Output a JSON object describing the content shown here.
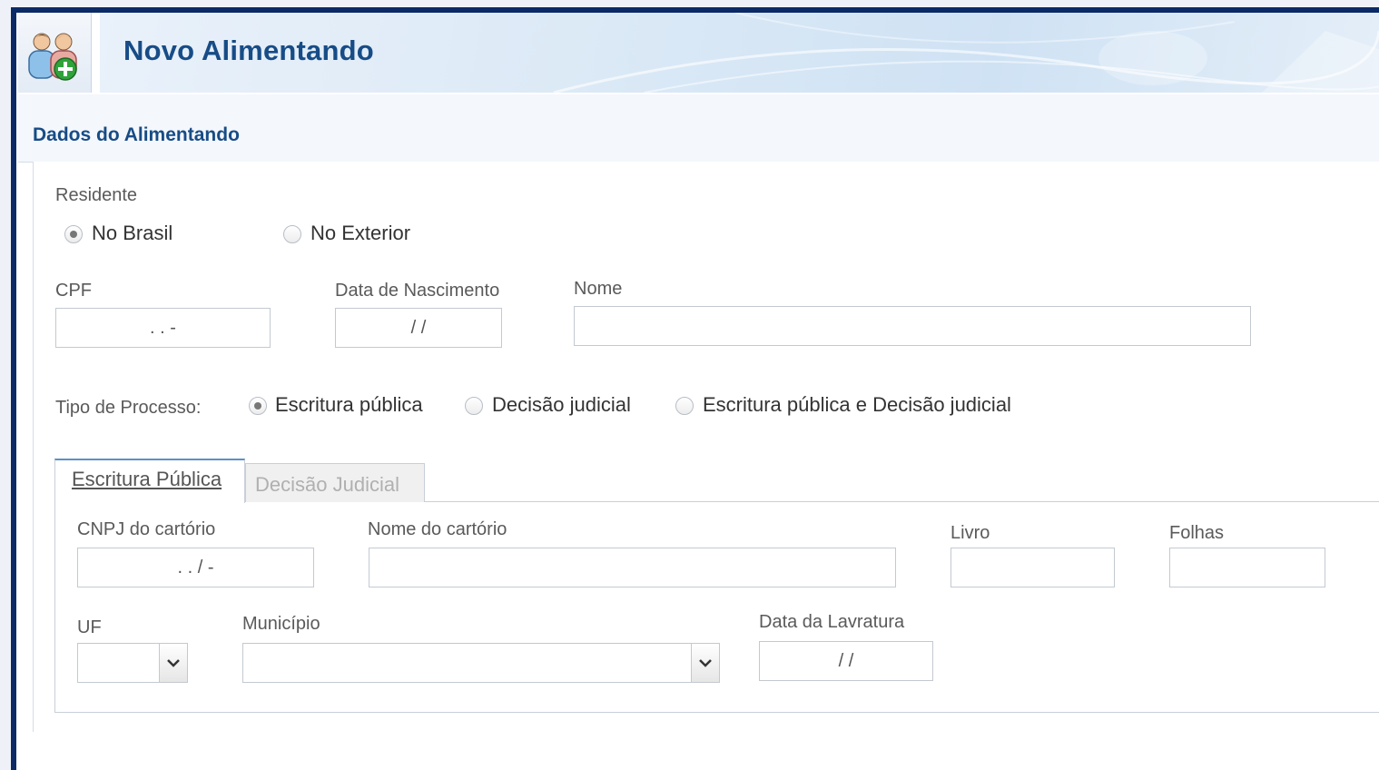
{
  "header": {
    "title": "Novo Alimentando",
    "icon": "add-people-icon"
  },
  "section": {
    "title": "Dados do Alimentando"
  },
  "residente": {
    "label": "Residente",
    "options": [
      "No Brasil",
      "No Exterior"
    ],
    "selected": "No Brasil"
  },
  "fields": {
    "cpf": {
      "label": "CPF",
      "value": ". . -"
    },
    "data_nascimento": {
      "label": "Data de Nascimento",
      "value": "/ /"
    },
    "nome": {
      "label": "Nome",
      "value": ""
    }
  },
  "tipo_processo": {
    "label": "Tipo de Processo:",
    "options": [
      "Escritura pública",
      "Decisão judicial",
      "Escritura pública e Decisão judicial"
    ],
    "selected": "Escritura pública"
  },
  "tabs": [
    {
      "label": "Escritura Pública",
      "active": true
    },
    {
      "label": "Decisão Judicial",
      "active": false
    }
  ],
  "escritura": {
    "cnpj": {
      "label": "CNPJ do cartório",
      "value": ". . / -"
    },
    "nome_cartorio": {
      "label": "Nome do cartório",
      "value": ""
    },
    "livro": {
      "label": "Livro",
      "value": ""
    },
    "folhas": {
      "label": "Folhas",
      "value": ""
    },
    "uf": {
      "label": "UF",
      "value": ""
    },
    "municipio": {
      "label": "Município",
      "value": ""
    },
    "data_lavratura": {
      "label": "Data da Lavratura",
      "value": "/ /"
    }
  },
  "colors": {
    "title": "#174c86",
    "frame": "#0b2a66"
  }
}
